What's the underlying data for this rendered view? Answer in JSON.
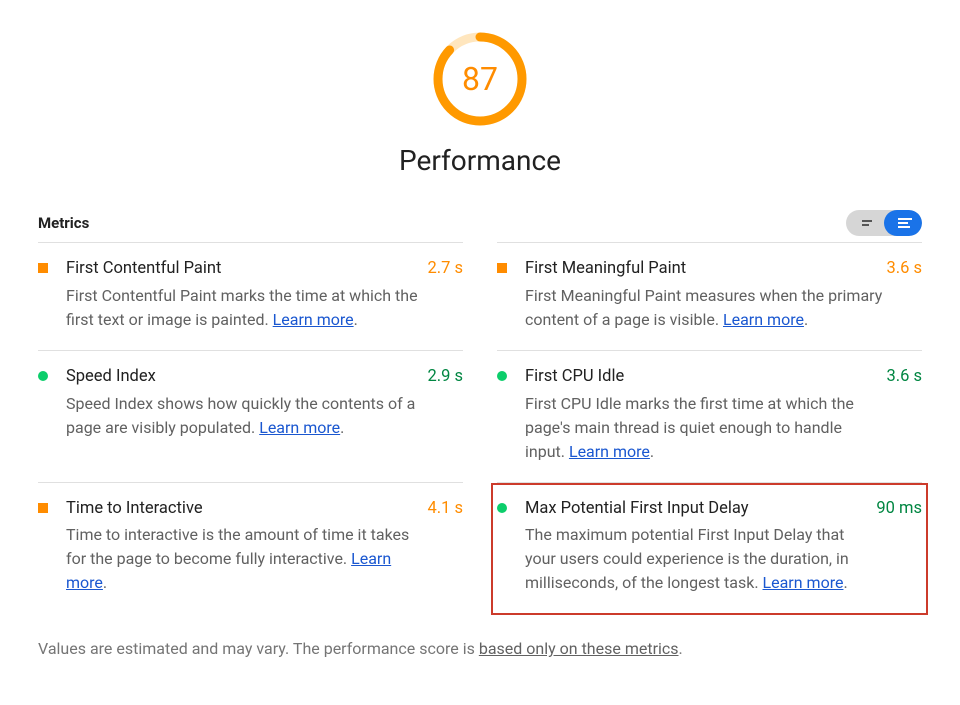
{
  "header": {
    "score": "87",
    "title": "Performance",
    "score_percent": 87,
    "gauge_color": "#ff9900"
  },
  "metrics_label": "Metrics",
  "learn_more_label": "Learn more",
  "metrics": [
    {
      "title": "First Contentful Paint",
      "desc": "First Contentful Paint marks the time at which the first text or image is painted. ",
      "value": "2.7 s",
      "status": "orange"
    },
    {
      "title": "First Meaningful Paint",
      "desc": "First Meaningful Paint measures when the primary content of a page is visible. ",
      "value": "3.6 s",
      "status": "orange"
    },
    {
      "title": "Speed Index",
      "desc": "Speed Index shows how quickly the contents of a page are visibly populated. ",
      "value": "2.9 s",
      "status": "green"
    },
    {
      "title": "First CPU Idle",
      "desc": "First CPU Idle marks the first time at which the page's main thread is quiet enough to handle input. ",
      "value": "3.6 s",
      "status": "green"
    },
    {
      "title": "Time to Interactive",
      "desc": "Time to interactive is the amount of time it takes for the page to become fully interactive. ",
      "value": "4.1 s",
      "status": "orange"
    },
    {
      "title": "Max Potential First Input Delay",
      "desc": "The maximum potential First Input Delay that your users could experience is the duration, in milliseconds, of the longest task. ",
      "value": "90 ms",
      "status": "green",
      "highlighted": true
    }
  ],
  "footnote": {
    "prefix": "Values are estimated and may vary. The performance score is ",
    "link": "based only on these metrics",
    "suffix": "."
  }
}
